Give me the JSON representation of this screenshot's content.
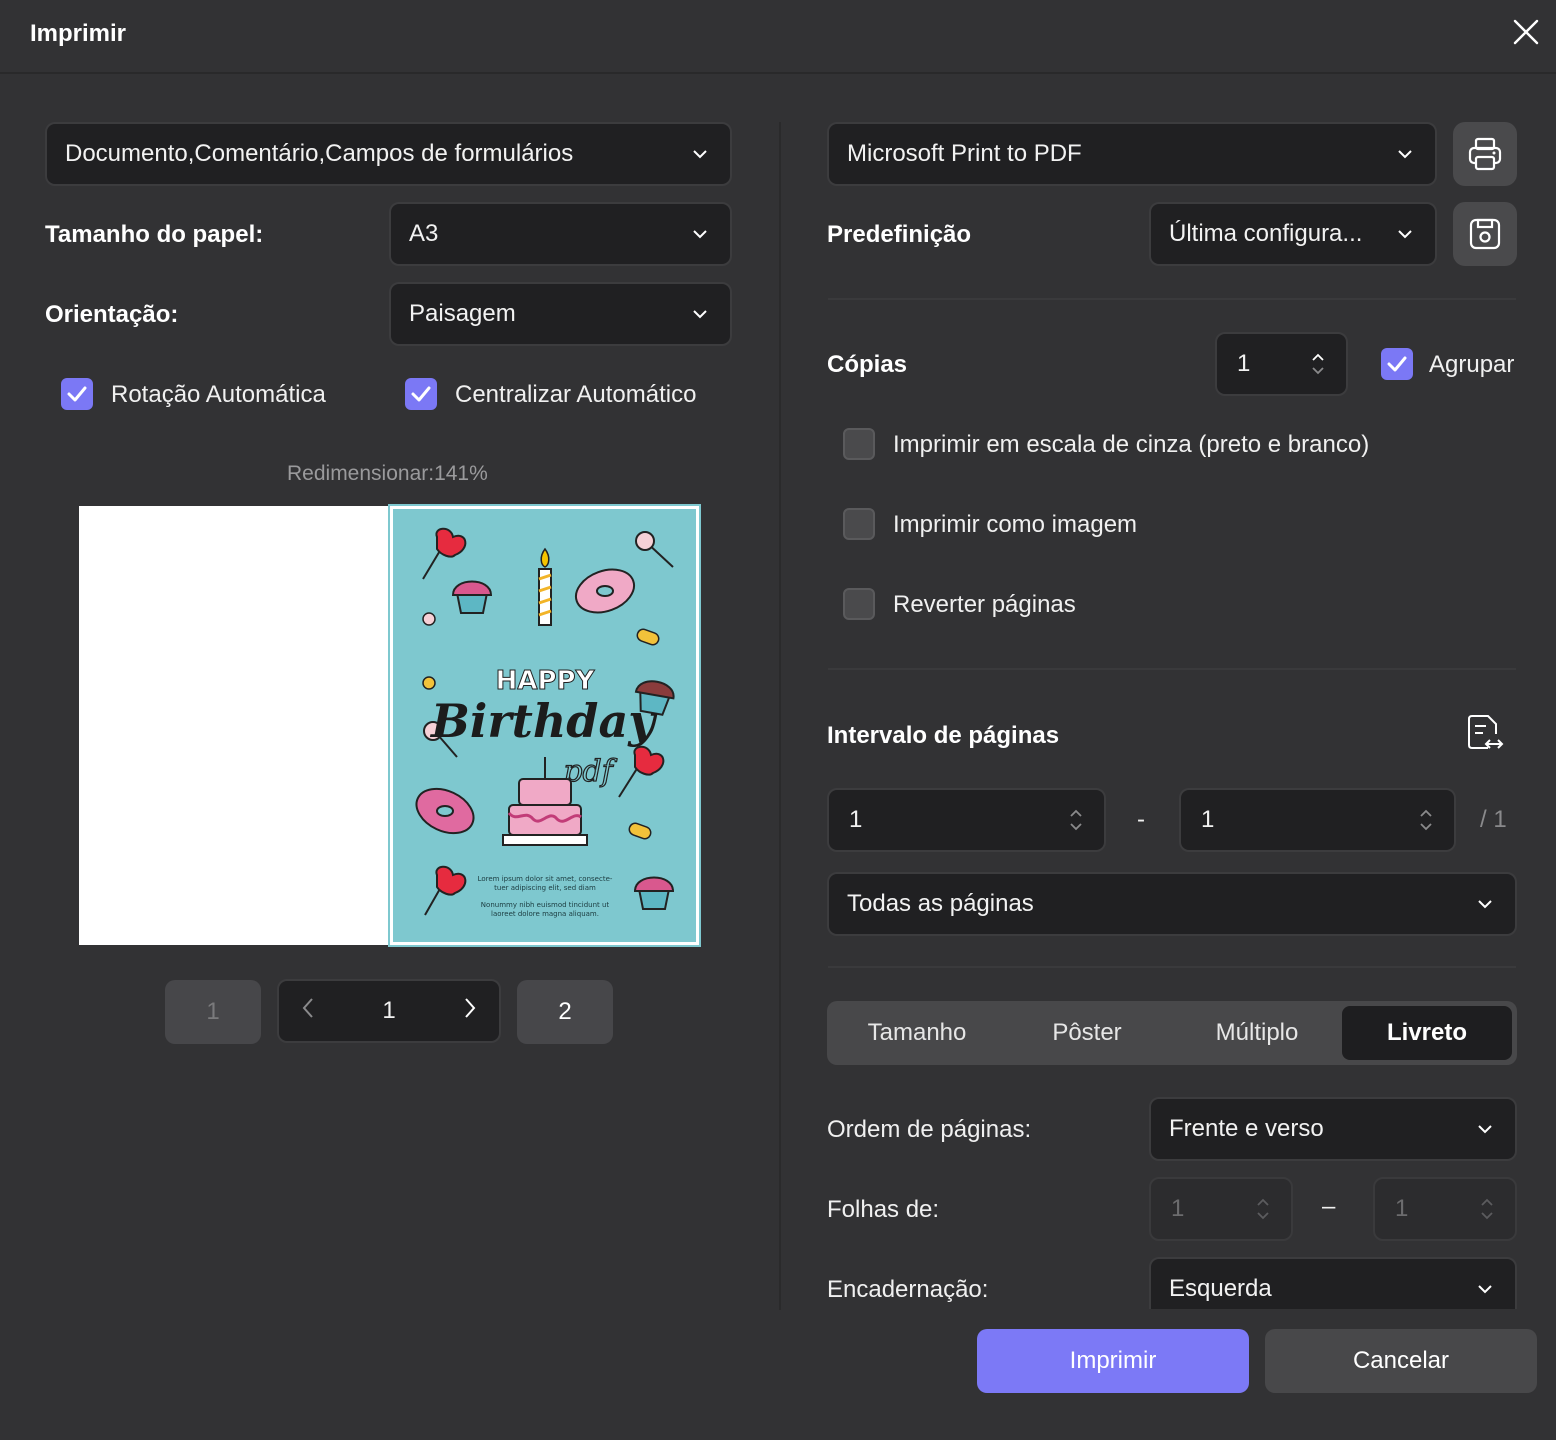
{
  "window": {
    "title": "Imprimir"
  },
  "left": {
    "content_select": "Documento,Comentário,Campos de formulários",
    "paper_size_label": "Tamanho do papel:",
    "paper_size_value": "A3",
    "orientation_label": "Orientação:",
    "orientation_value": "Paisagem",
    "auto_rotate_label": "Rotação Automática",
    "auto_rotate_checked": true,
    "auto_center_label": "Centralizar Automático",
    "auto_center_checked": true,
    "scale_text": "Redimensionar:141%",
    "preview": {
      "happy": "HAPPY",
      "birthday": "Birthday",
      "brand": "pdf",
      "lorem1": "Lorem ipsum dolor sit amet, consecte-",
      "lorem2": "tuer adipiscing elit, sed diam",
      "lorem3": "Nonummy nibh euismod tincidunt ut",
      "lorem4": "laoreet dolore magna aliquam."
    },
    "pager": {
      "first": "1",
      "current": "1",
      "last": "2"
    }
  },
  "right": {
    "printer_value": "Microsoft Print to PDF",
    "preset_label": "Predefinição",
    "preset_value": "Última configura...",
    "copies_label": "Cópias",
    "copies_value": "1",
    "collate_label": "Agrupar",
    "collate_checked": true,
    "grayscale_label": "Imprimir em escala de cinza (preto e branco)",
    "as_image_label": "Imprimir como imagem",
    "reverse_label": "Reverter páginas",
    "range_label": "Intervalo de páginas",
    "range_from": "1",
    "range_dash": "-",
    "range_to": "1",
    "range_total": "/ 1",
    "pages_select": "Todas as páginas",
    "tabs": [
      "Tamanho",
      "Pôster",
      "Múltiplo",
      "Livreto"
    ],
    "active_tab": "Livreto",
    "page_order_label": "Ordem de páginas:",
    "page_order_value": "Frente e verso",
    "sheets_label": "Folhas de:",
    "sheets_from": "1",
    "sheets_dash": "–",
    "sheets_to": "1",
    "binding_label": "Encadernação:",
    "binding_value": "Esquerda"
  },
  "footer": {
    "print_label": "Imprimir",
    "cancel_label": "Cancelar"
  },
  "colors": {
    "accent": "#7c79f6",
    "background": "#323234",
    "field": "#202022",
    "card": "#7ec8cf"
  }
}
